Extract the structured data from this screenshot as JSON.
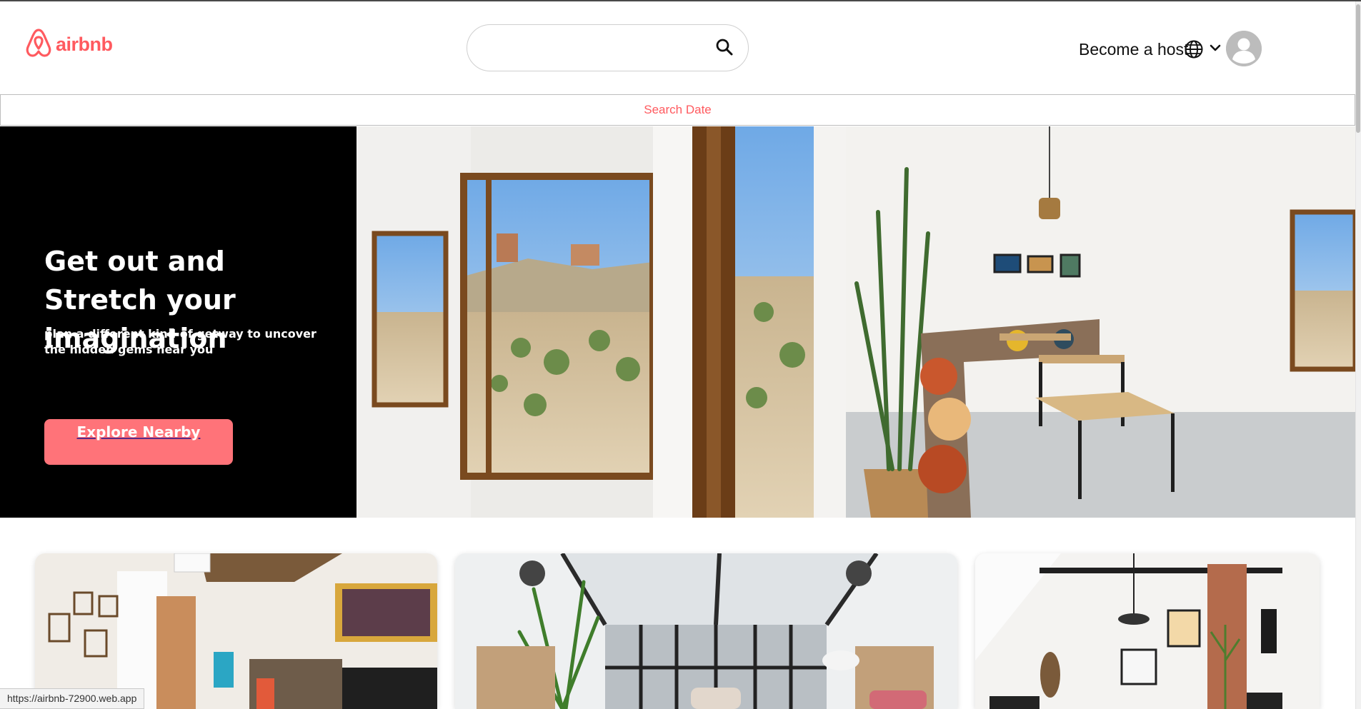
{
  "header": {
    "logo_text": "airbnb",
    "search": {
      "value": "",
      "placeholder": ""
    },
    "host_label": "Become a host",
    "icons": [
      "airbnb-logo-icon",
      "search-icon",
      "globe-icon",
      "chevron-down-icon",
      "user-avatar-icon"
    ]
  },
  "date_bar": {
    "label": "Search Date"
  },
  "hero": {
    "title": "Get out and Stretch your imagination",
    "subtitle": "plan a different kind of getway to uncover the hidden gems near you",
    "button_label": "Explore Nearby"
  },
  "status_bar": {
    "url": "https://airbnb-72900.web.app"
  },
  "colors": {
    "brand": "#ff5a5f",
    "button": "#ff7379",
    "hero_bg": "#000000"
  }
}
